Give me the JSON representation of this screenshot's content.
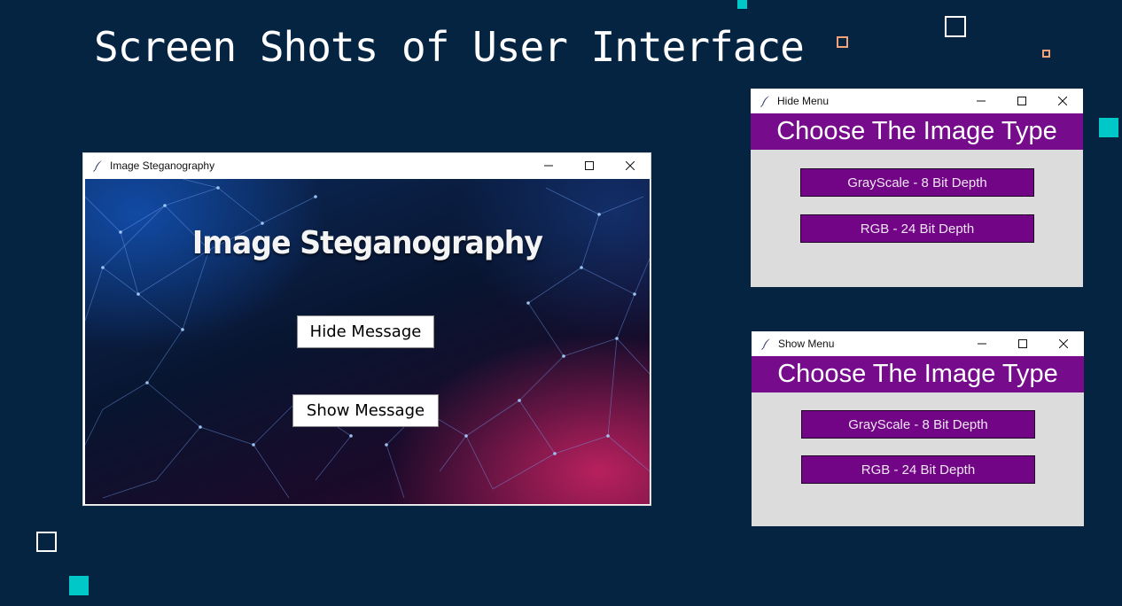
{
  "slide": {
    "title": "Screen Shots of User Interface"
  },
  "main_window": {
    "title": "Image Steganography",
    "heading": "Image Steganography",
    "hide_button": "Hide Message",
    "show_button": "Show Message"
  },
  "hide_menu": {
    "title": "Hide Menu",
    "banner": "Choose The Image Type",
    "grayscale_button": "GrayScale - 8 Bit Depth",
    "rgb_button": "RGB - 24 Bit Depth"
  },
  "show_menu": {
    "title": "Show Menu",
    "banner": "Choose The Image Type",
    "grayscale_button": "GrayScale - 8 Bit Depth",
    "rgb_button": "RGB - 24 Bit Depth"
  },
  "colors": {
    "background": "#042442",
    "accent_teal": "#00c8c8",
    "menu_purple": "#760b8c",
    "menu_body": "#dcdcdc"
  },
  "icons": {
    "window_icon": "feather-icon",
    "minimize": "minimize-icon",
    "maximize": "maximize-icon",
    "close": "close-icon"
  }
}
